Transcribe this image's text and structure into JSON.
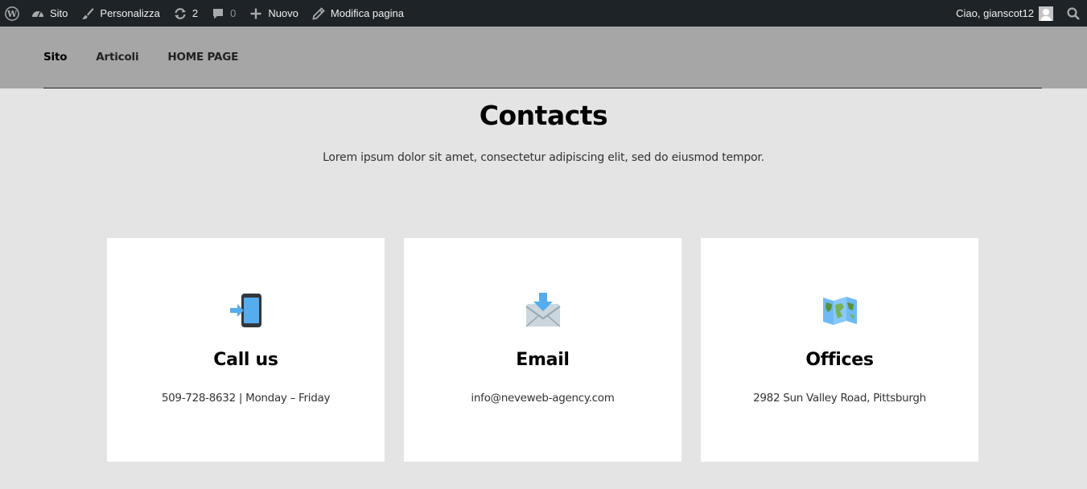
{
  "adminbar": {
    "items": [
      {
        "icon": "wordpress-logo-icon",
        "label": ""
      },
      {
        "icon": "dashboard-icon",
        "label": "Sito"
      },
      {
        "icon": "paintbrush-icon",
        "label": "Personalizza"
      },
      {
        "icon": "updates-icon",
        "label": "2"
      },
      {
        "icon": "comment-icon",
        "label": "0"
      },
      {
        "icon": "plus-icon",
        "label": "Nuovo"
      },
      {
        "icon": "pencil-icon",
        "label": "Modifica pagina"
      }
    ],
    "greeting": "Ciao, gianscot12",
    "search_icon": "search-icon",
    "bg_color": "#1d2327"
  },
  "nav": {
    "items": [
      "Sito",
      "Articoli",
      "HOME PAGE"
    ]
  },
  "page": {
    "title": "Contacts",
    "subtitle": "Lorem ipsum dolor sit amet, consectetur adipiscing elit, sed do eiusmod tempor."
  },
  "cards": [
    {
      "icon": "mobile-phone-arrow-icon",
      "title": "Call us",
      "text": "509-728-8632 | Monday – Friday"
    },
    {
      "icon": "envelope-arrow-icon",
      "title": "Email",
      "text": "info@neveweb-agency.com"
    },
    {
      "icon": "world-map-icon",
      "title": "Offices",
      "text": "2982 Sun Valley Road, Pittsburgh"
    }
  ],
  "colors": {
    "header_bg": "#a6a6a6",
    "page_bg": "#e4e4e4",
    "card_bg": "#ffffff"
  }
}
